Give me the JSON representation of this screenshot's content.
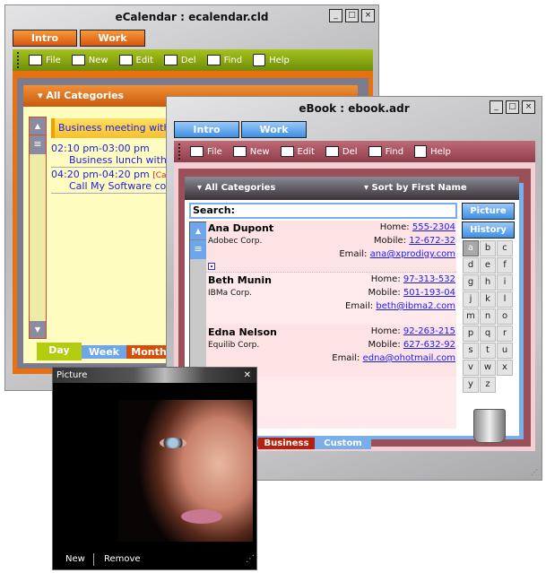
{
  "calendar": {
    "title": "eCalendar : ecalendar.cld",
    "tabs": [
      "Intro",
      "Work"
    ],
    "toolbar": [
      {
        "label": "File",
        "icon": "file-icon"
      },
      {
        "label": "New",
        "icon": "new-icon"
      },
      {
        "label": "Edit",
        "icon": "edit-icon"
      },
      {
        "label": "Del",
        "icon": "delete-icon"
      },
      {
        "label": "Find",
        "icon": "find-icon"
      },
      {
        "label": "Help",
        "icon": "help-icon"
      }
    ],
    "category": "All Categories",
    "banner": "Business meeting with Larry",
    "events": [
      {
        "time": "02:10 pm-03:00 pm",
        "tag": "",
        "text": "Business lunch with Jane"
      },
      {
        "time": "04:20 pm-04:20 pm",
        "tag": "[Calls]",
        "text": "Call My Software corp."
      }
    ],
    "view_tabs": [
      "Day",
      "Week",
      "Month"
    ],
    "active_view": "Day",
    "colors": {
      "accent": "#e8700f",
      "toolbar": "#8aa812",
      "content": "#fffcc0"
    }
  },
  "ebook": {
    "title": "eBook : ebook.adr",
    "tabs": [
      "Intro",
      "Work"
    ],
    "toolbar": [
      {
        "label": "File",
        "icon": "file-icon"
      },
      {
        "label": "New",
        "icon": "new-icon"
      },
      {
        "label": "Edit",
        "icon": "edit-icon"
      },
      {
        "label": "Del",
        "icon": "delete-icon"
      },
      {
        "label": "Find",
        "icon": "find-icon"
      },
      {
        "label": "Help",
        "icon": "help-icon"
      }
    ],
    "category": "All Categories",
    "sort": "Sort by First Name",
    "search_label": "Search:",
    "search_value": "",
    "picture_button": "Picture",
    "history_button": "History",
    "letters": [
      "a",
      "b",
      "c",
      "d",
      "e",
      "f",
      "g",
      "h",
      "i",
      "j",
      "k",
      "l",
      "m",
      "n",
      "o",
      "p",
      "q",
      "r",
      "s",
      "t",
      "u",
      "v",
      "w",
      "x",
      "y",
      "z"
    ],
    "selected_letter": "a",
    "contacts": [
      {
        "name": "Ana Dupont",
        "company": "Adobec Corp.",
        "home_label": "Home:",
        "home": "555-2304",
        "mobile_label": "Mobile:",
        "mobile": "12-672-32",
        "email_label": "Email:",
        "email": "ana@xprodigy.com"
      },
      {
        "name": "Beth Munin",
        "company": "IBMa Corp.",
        "home_label": "Home:",
        "home": "97-313-532",
        "mobile_label": "Mobile:",
        "mobile": "501-193-04",
        "email_label": "Email:",
        "email": "beth@ibma2.com"
      },
      {
        "name": "Edna Nelson",
        "company": "Equilib Corp.",
        "home_label": "Home:",
        "home": "92-263-215",
        "mobile_label": "Mobile:",
        "mobile": "627-632-92",
        "email_label": "Email:",
        "email": "edna@ohotmail.com"
      }
    ],
    "group_tabs": [
      "Business",
      "Custom"
    ],
    "colors": {
      "toolbar": "#a24c5a",
      "frame": "#9a5058",
      "accent": "#5aa0ee"
    }
  },
  "picture": {
    "title": "Picture",
    "new_label": "New",
    "remove_label": "Remove"
  }
}
